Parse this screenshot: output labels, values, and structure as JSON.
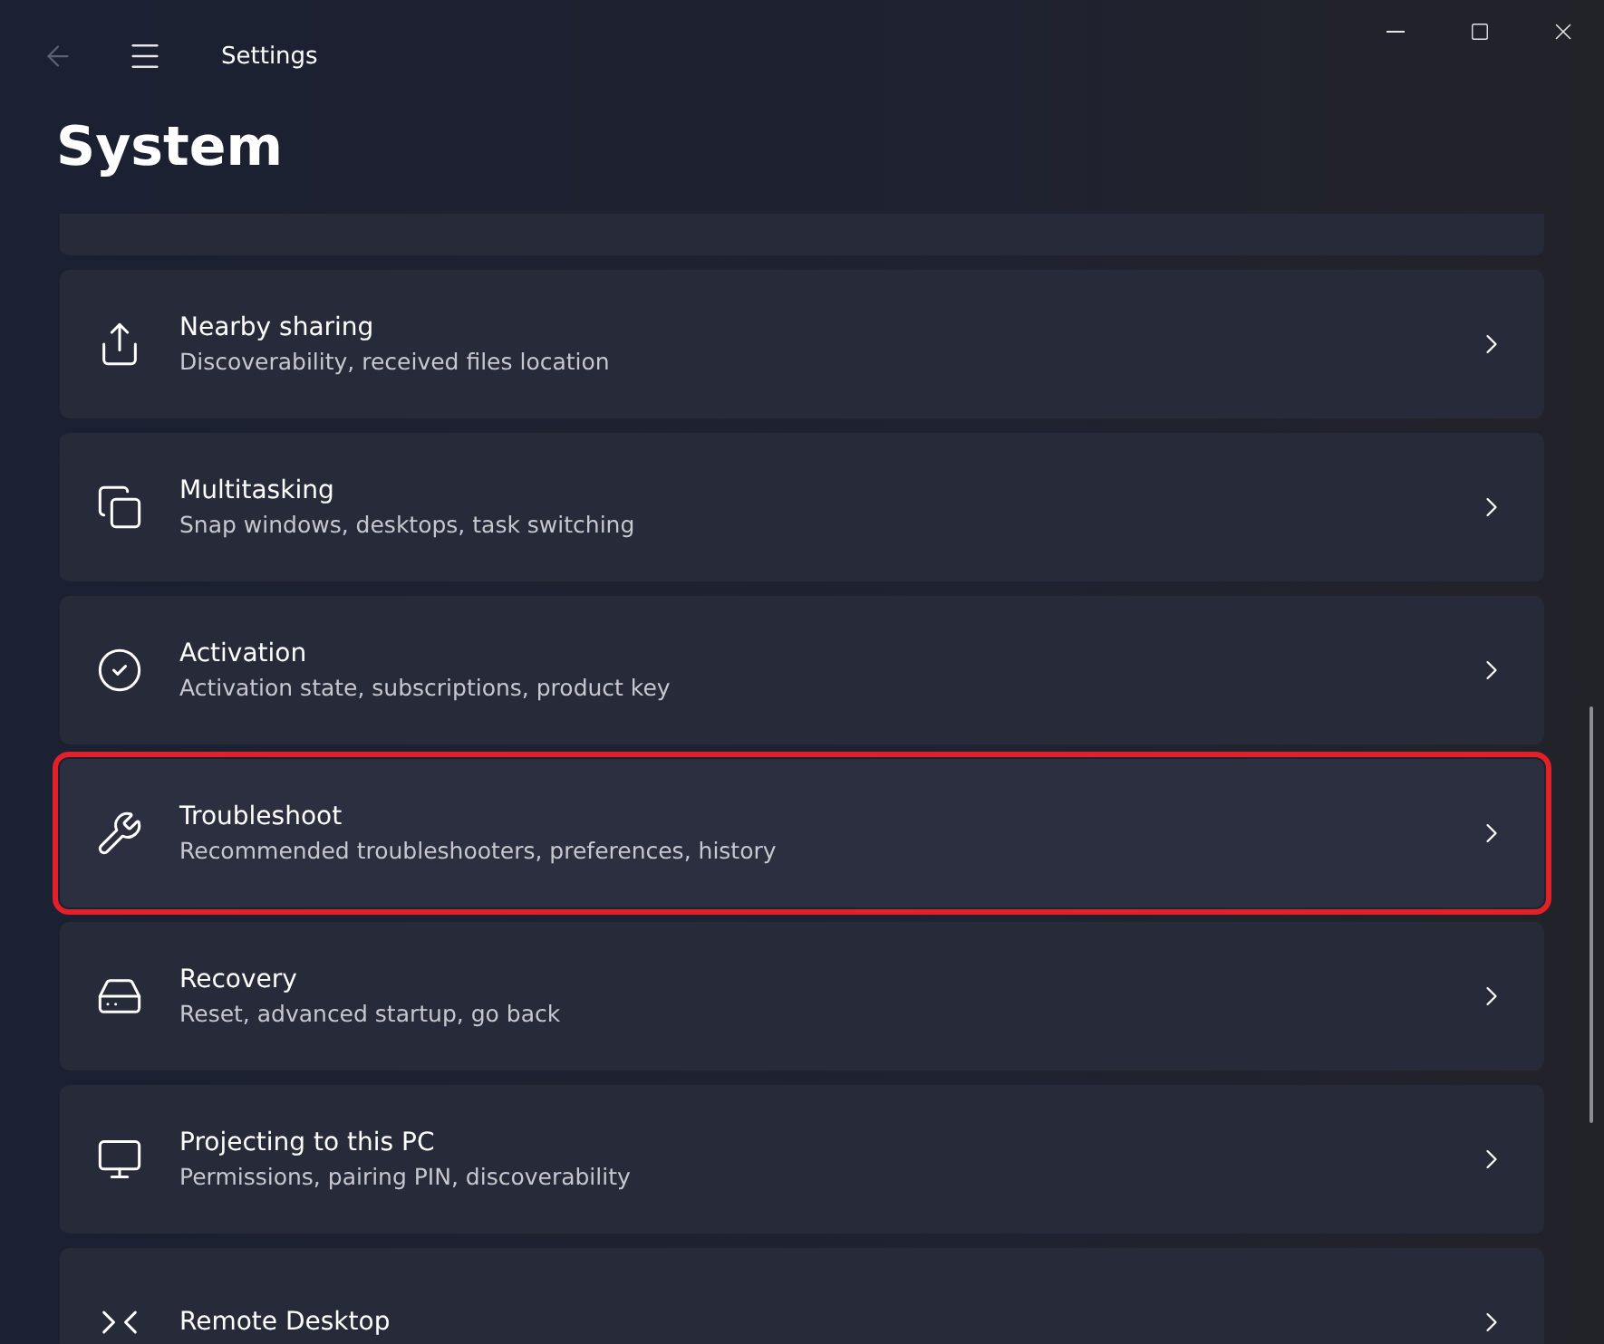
{
  "window": {
    "title": "Settings",
    "back_disabled": true
  },
  "page": {
    "title": "System"
  },
  "items": [
    {
      "highlighted": false
    },
    {
      "title": "Nearby sharing",
      "subtitle": "Discoverability, received files location",
      "highlighted": false
    },
    {
      "title": "Multitasking",
      "subtitle": "Snap windows, desktops, task switching",
      "highlighted": false
    },
    {
      "title": "Activation",
      "subtitle": "Activation state, subscriptions, product key",
      "highlighted": false
    },
    {
      "title": "Troubleshoot",
      "subtitle": "Recommended troubleshooters, preferences, history",
      "highlighted": true
    },
    {
      "title": "Recovery",
      "subtitle": "Reset, advanced startup, go back",
      "highlighted": false
    },
    {
      "title": "Projecting to this PC",
      "subtitle": "Permissions, pairing PIN, discoverability",
      "highlighted": false
    },
    {
      "title": "Remote Desktop",
      "highlighted": false
    }
  ]
}
